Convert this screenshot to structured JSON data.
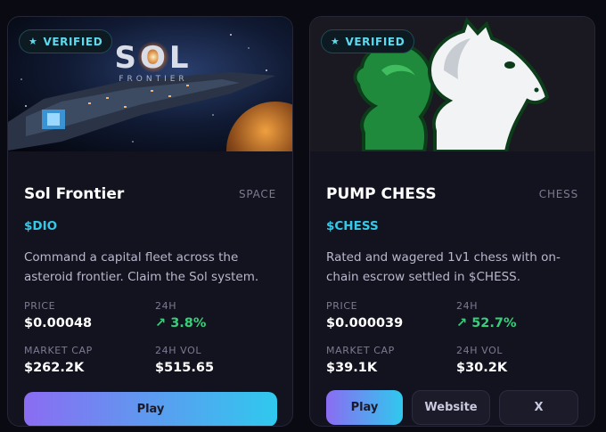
{
  "cards": [
    {
      "verified": "VERIFIED",
      "banner_text": "SOL",
      "banner_subtext": "FRONTIER",
      "title": "Sol Frontier",
      "category": "SPACE",
      "ticker": "$DIO",
      "description": "Command a capital fleet across the asteroid frontier. Claim the Sol system.",
      "stats": {
        "price_label": "PRICE",
        "price": "$0.00048",
        "change_label": "24H",
        "change": "↗ 3.8%",
        "mcap_label": "MARKET CAP",
        "mcap": "$262.2K",
        "vol_label": "24H VOL",
        "vol": "$515.65"
      },
      "buttons": {
        "play": "Play"
      }
    },
    {
      "verified": "VERIFIED",
      "title": "PUMP CHESS",
      "category": "CHESS",
      "ticker": "$CHESS",
      "description": "Rated and wagered 1v1 chess with on-chain escrow settled in $CHESS.",
      "stats": {
        "price_label": "PRICE",
        "price": "$0.000039",
        "change_label": "24H",
        "change": "↗ 52.7%",
        "mcap_label": "MARKET CAP",
        "mcap": "$39.1K",
        "vol_label": "24H VOL",
        "vol": "$30.2K"
      },
      "buttons": {
        "play": "Play",
        "website": "Website",
        "x": "X"
      }
    }
  ],
  "colors": {
    "accent_cyan": "#36c8e6",
    "positive": "#35d07a",
    "play_gradient_start": "#8b6cf2",
    "play_gradient_end": "#2fc9ee"
  },
  "icons": [
    "star-icon",
    "arrow-up-right-icon"
  ]
}
